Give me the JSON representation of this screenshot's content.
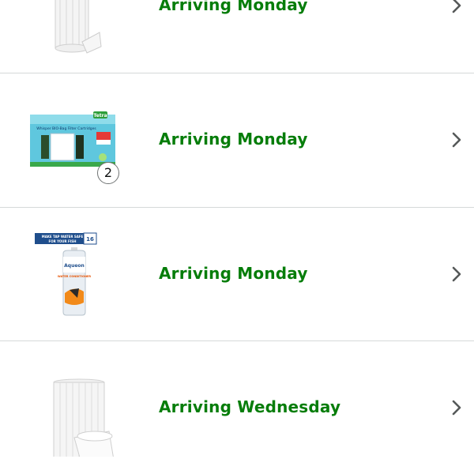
{
  "orders": [
    {
      "status": "Arriving Monday",
      "thumbnail_icon": "baking-cups-icon"
    },
    {
      "status": "Arriving Monday",
      "thumbnail_icon": "filter-cartridge-box-icon",
      "box_brand": "Tetra",
      "box_text": "Whisper BIO-Bag Filter Cartridges",
      "quantity": "2"
    },
    {
      "status": "Arriving Monday",
      "thumbnail_icon": "water-conditioner-bottle-icon",
      "banner_line1": "MAKE TAP WATER SAFE",
      "banner_line2": "FOR YOUR FISH",
      "size_number": "16",
      "bottle_brand": "Aqueon",
      "bottle_label": "WATER CONDITIONER"
    },
    {
      "status": "Arriving Wednesday",
      "thumbnail_icon": "baking-cups-icon"
    }
  ],
  "colors": {
    "status_green": "#067d0a",
    "divider": "#d5d9d9",
    "chevron": "#565959"
  },
  "icons": {
    "row_chevron": "chevron-right-icon"
  }
}
